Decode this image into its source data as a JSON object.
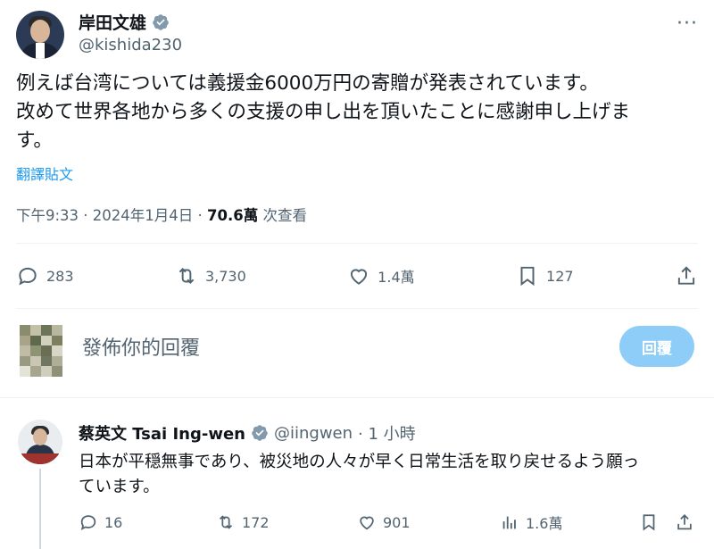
{
  "tweet": {
    "author_name": "岸田文雄",
    "author_handle": "@kishida230",
    "more_label": "···",
    "text_line1": "例えば台湾については義援金6000万円の寄贈が発表されています。",
    "text_line2": "改めて世界各地から多くの支援の申し出を頂いたことに感謝申し上げま",
    "text_line3": "す。",
    "translate_label": "翻譯貼文",
    "time": "下午9:33 · 2024年1月4日 · ",
    "views_count": "70.6萬",
    "views_label": " 次查看",
    "actions": {
      "replies": "283",
      "retweets": "3,730",
      "likes": "1.4萬",
      "bookmarks": "127"
    }
  },
  "composer": {
    "placeholder": "發佈你的回覆",
    "reply_button": "回覆"
  },
  "reply": {
    "author_name": "蔡英文 Tsai Ing-wen",
    "author_handle": "@iingwen",
    "time": "· 1 小時",
    "text_line1": "日本が平穏無事であり、被災地の人々が早く日常生活を取り戻せるよう願っ",
    "text_line2": "ています。",
    "actions": {
      "replies": "16",
      "retweets": "172",
      "likes": "901",
      "views": "1.6萬"
    }
  },
  "colors": {
    "accent": "#1d9bf0",
    "muted": "#536471",
    "reply_button_disabled": "#8ecdf8"
  }
}
